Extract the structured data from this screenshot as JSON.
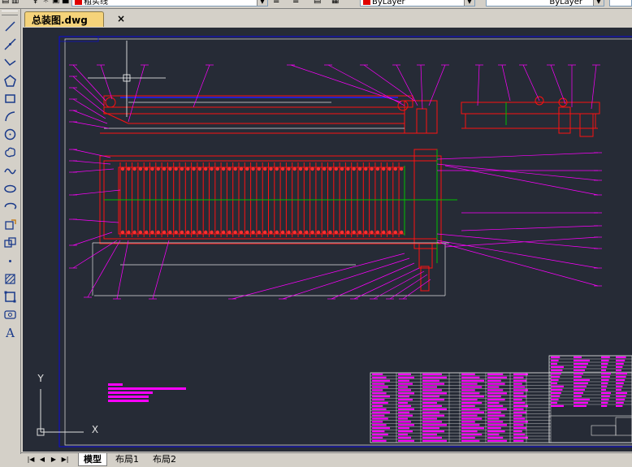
{
  "toolbar": {
    "linetype_value": "粗实线",
    "color_value": "ByLayer",
    "lineweight_value": "ByLayer",
    "color_swatch": "#e00000"
  },
  "document": {
    "tab_title": "总装图.dwg",
    "close_label": "×"
  },
  "draw_tools": [
    {
      "name": "line-tool",
      "icon": "line-icon"
    },
    {
      "name": "construction-line-tool",
      "icon": "xline-icon"
    },
    {
      "name": "polyline-tool",
      "icon": "polyline-icon"
    },
    {
      "name": "polygon-tool",
      "icon": "polygon-icon"
    },
    {
      "name": "rectangle-tool",
      "icon": "rectangle-icon"
    },
    {
      "name": "arc-tool",
      "icon": "arc-icon"
    },
    {
      "name": "circle-tool",
      "icon": "circle-icon"
    },
    {
      "name": "revision-cloud-tool",
      "icon": "cloud-icon"
    },
    {
      "name": "spline-tool",
      "icon": "spline-icon"
    },
    {
      "name": "ellipse-tool",
      "icon": "ellipse-icon"
    },
    {
      "name": "ellipse-arc-tool",
      "icon": "ellipse-arc-icon"
    },
    {
      "name": "insert-block-tool",
      "icon": "insert-block-icon"
    },
    {
      "name": "make-block-tool",
      "icon": "make-block-icon"
    },
    {
      "name": "point-tool",
      "icon": "point-icon"
    },
    {
      "name": "hatch-tool",
      "icon": "hatch-icon"
    },
    {
      "name": "region-tool",
      "icon": "region-icon"
    },
    {
      "name": "table-tool",
      "icon": "table-icon"
    },
    {
      "name": "multiline-text-tool",
      "icon": "text-icon",
      "label": "A"
    }
  ],
  "layout_tabs": [
    {
      "label": "模型",
      "active": true
    },
    {
      "label": "布局1",
      "active": false
    },
    {
      "label": "布局2",
      "active": false
    }
  ],
  "nav_buttons": [
    "first-tab",
    "prev-tab",
    "next-tab",
    "last-tab"
  ],
  "ucs": {
    "y_label": "Y",
    "x_label": "X"
  },
  "colors": {
    "canvas_bg": "#262b36",
    "frame_blue": "#1010c0",
    "drawing_red": "#ff1010",
    "leader_magenta": "#ff00ff",
    "dimension_white": "#e0e0e0",
    "centerline_green": "#00c000"
  }
}
